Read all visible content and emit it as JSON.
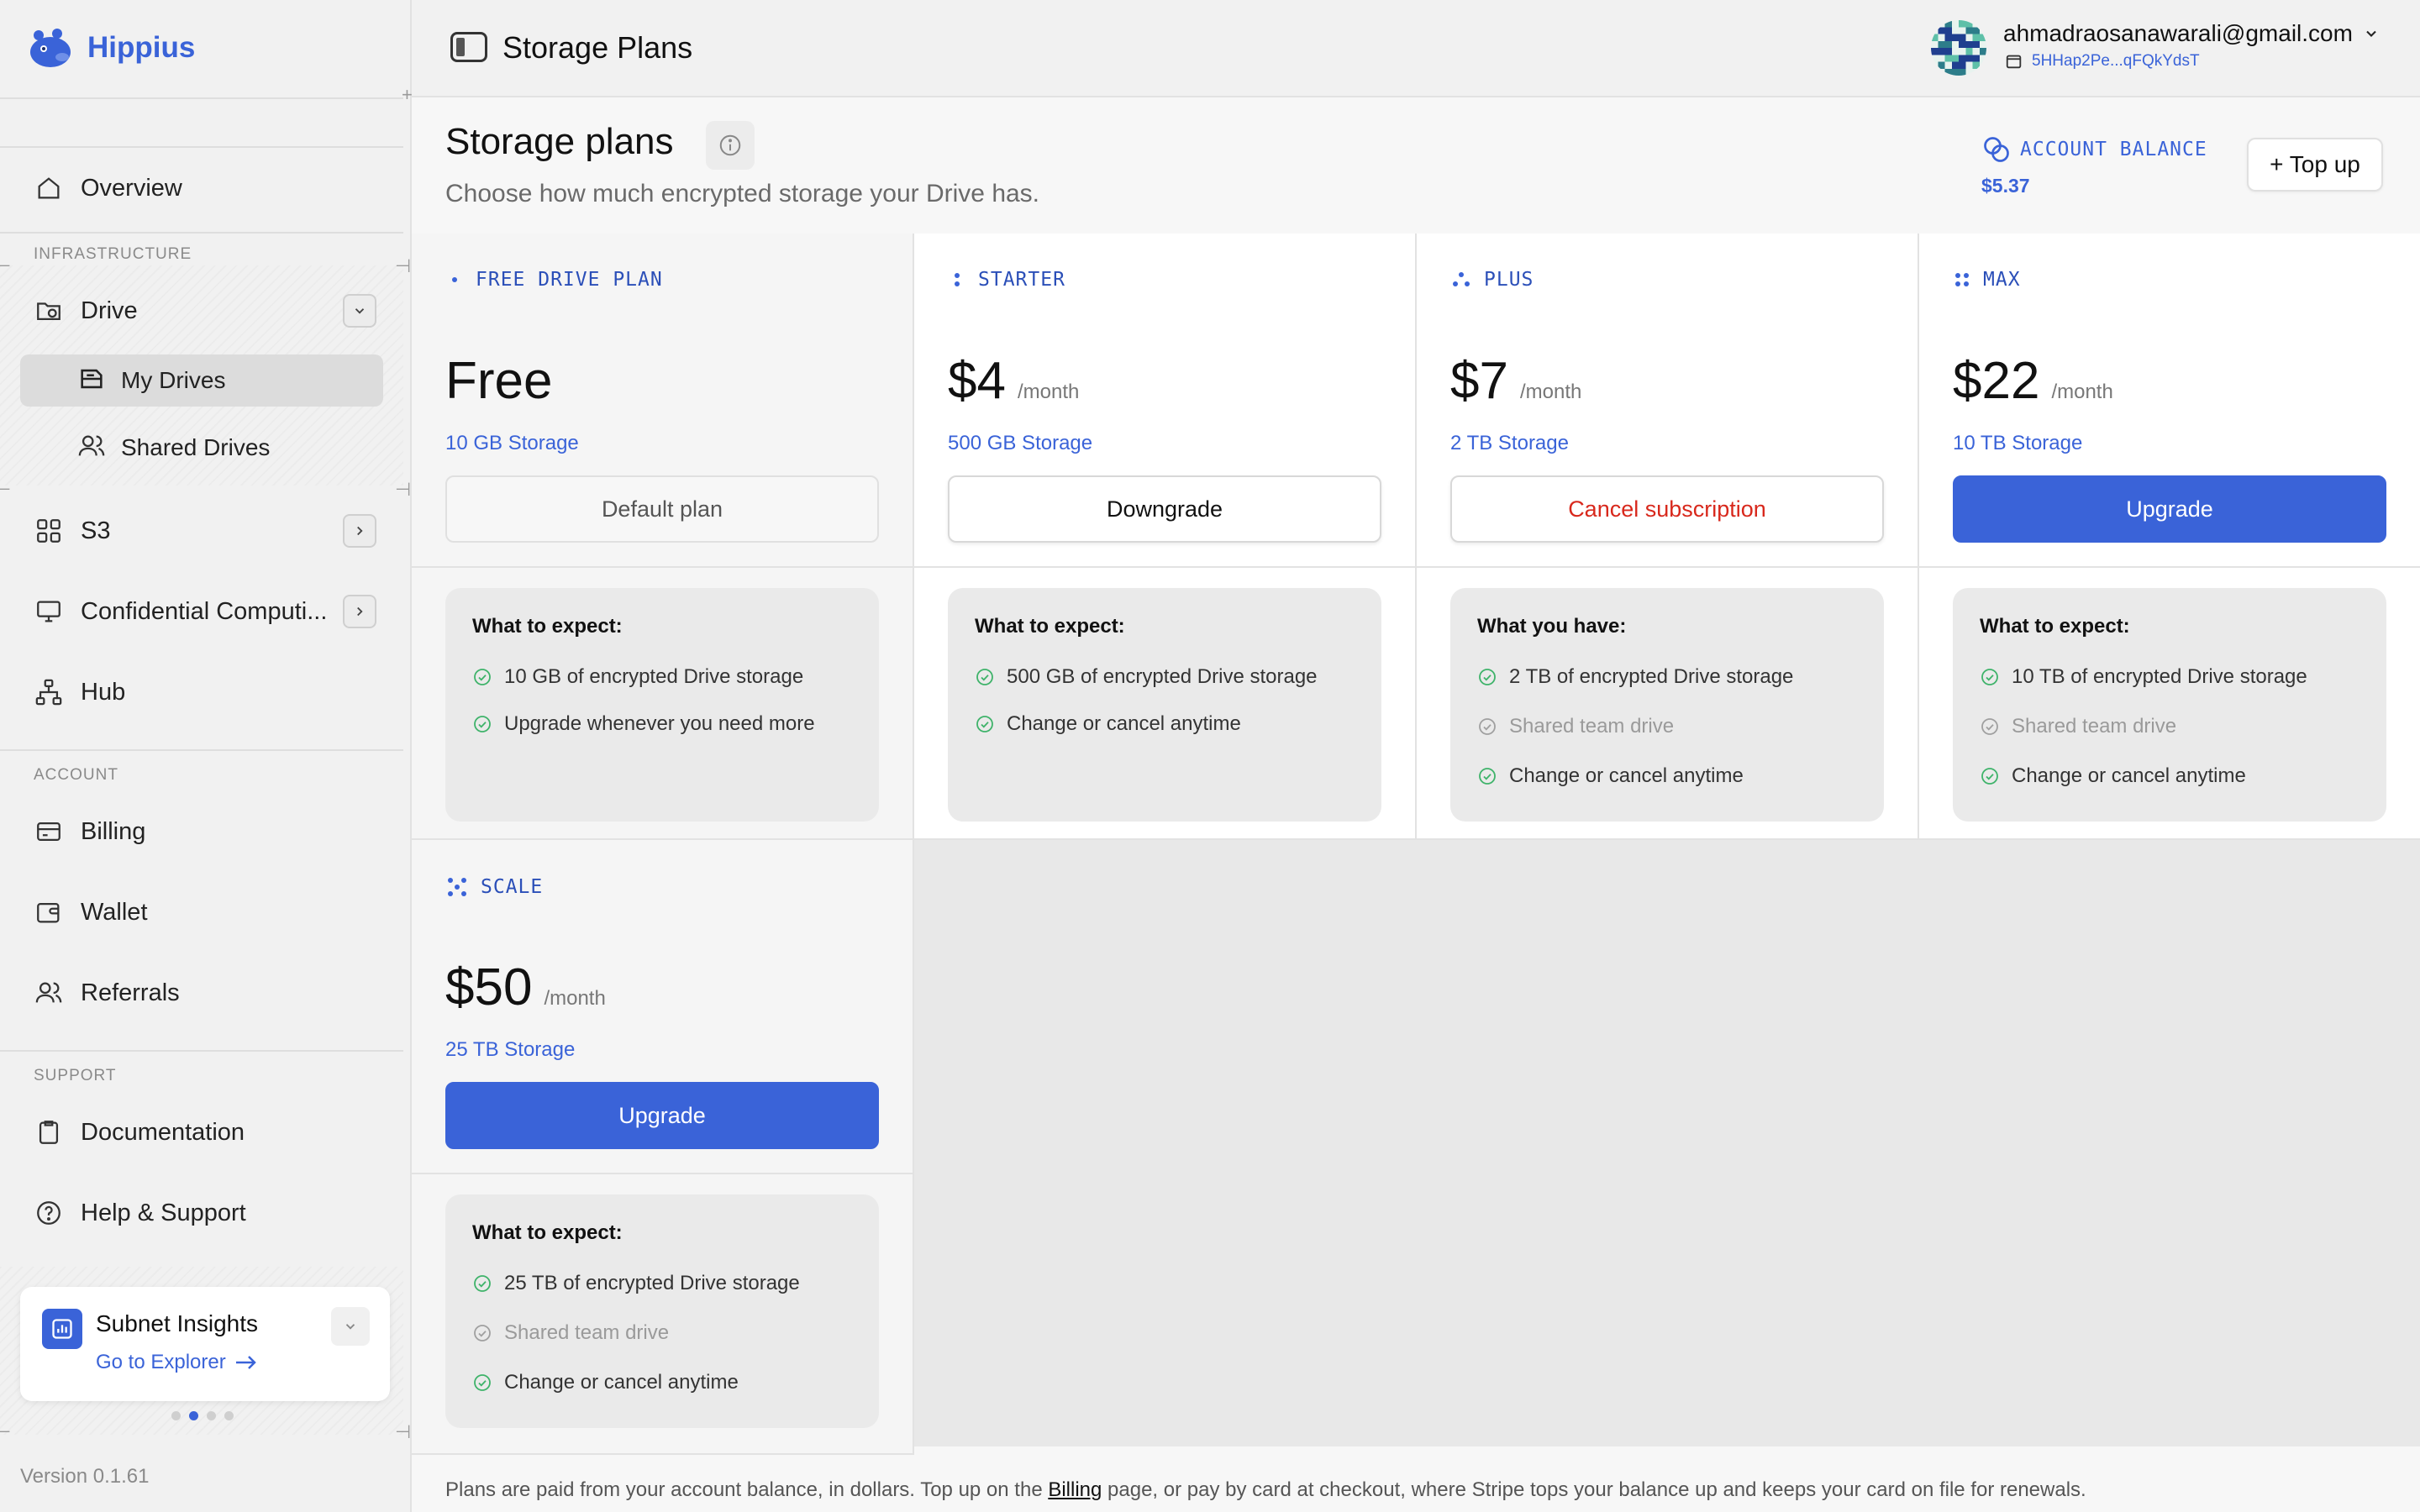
{
  "app": {
    "name": "Hippius"
  },
  "sidebar": {
    "overview": "Overview",
    "sections": {
      "infrastructure": "INFRASTRUCTURE",
      "account": "ACCOUNT",
      "support": "SUPPORT"
    },
    "drive": "Drive",
    "my_drives": "My Drives",
    "shared_drives": "Shared Drives",
    "s3": "S3",
    "confidential": "Confidential Computi...",
    "hub": "Hub",
    "billing": "Billing",
    "wallet": "Wallet",
    "referrals": "Referrals",
    "documentation": "Documentation",
    "help": "Help & Support",
    "insights": {
      "title": "Subnet Insights",
      "link": "Go to Explorer",
      "slides": 4,
      "active_slide": 2
    },
    "version": "Version 0.1.61"
  },
  "header": {
    "title": "Storage Plans",
    "email": "ahmadraosanawarali@gmail.com",
    "wallet_address": "5HHap2Pe...qFQkYdsT"
  },
  "main": {
    "title": "Storage plans",
    "subtitle": "Choose how much encrypted storage your Drive has.",
    "balance_label": "ACCOUNT BALANCE",
    "balance_value": "$5.37",
    "topup_label": "+ Top up",
    "footnote_pre": "Plans are paid from your account balance, in dollars. Top up on the ",
    "footnote_link": "Billing",
    "footnote_post": " page, or pay by card at checkout, where Stripe tops your balance up and keeps your card on file for renewals."
  },
  "plans": [
    {
      "tag": "FREE DRIVE PLAN",
      "price": "Free",
      "period": "",
      "storage": "10 GB Storage",
      "button": "Default plan",
      "button_style": "default",
      "heading": "What to expect:",
      "features": [
        {
          "text": "10 GB of encrypted Drive storage",
          "on": true
        },
        {
          "text": "Upgrade whenever you need more",
          "on": true
        }
      ]
    },
    {
      "tag": "STARTER",
      "price": "$4",
      "period": "/month",
      "storage": "500 GB Storage",
      "button": "Downgrade",
      "button_style": "white",
      "heading": "What to expect:",
      "features": [
        {
          "text": "500 GB of encrypted Drive storage",
          "on": true
        },
        {
          "text": "Change or cancel anytime",
          "on": true
        }
      ]
    },
    {
      "tag": "PLUS",
      "price": "$7",
      "period": "/month",
      "storage": "2 TB Storage",
      "button": "Cancel subscription",
      "button_style": "danger",
      "heading": "What you have:",
      "features": [
        {
          "text": "2 TB of encrypted Drive storage",
          "on": true
        },
        {
          "text": "Shared team drive",
          "on": false
        },
        {
          "text": "Change or cancel anytime",
          "on": true
        }
      ]
    },
    {
      "tag": "MAX",
      "price": "$22",
      "period": "/month",
      "storage": "10 TB Storage",
      "button": "Upgrade",
      "button_style": "primary",
      "heading": "What to expect:",
      "features": [
        {
          "text": "10 TB of encrypted Drive storage",
          "on": true
        },
        {
          "text": "Shared team drive",
          "on": false
        },
        {
          "text": "Change or cancel anytime",
          "on": true
        }
      ]
    },
    {
      "tag": "SCALE",
      "price": "$50",
      "period": "/month",
      "storage": "25 TB Storage",
      "button": "Upgrade",
      "button_style": "primary",
      "heading": "What to expect:",
      "features": [
        {
          "text": "25 TB of encrypted Drive storage",
          "on": true
        },
        {
          "text": "Shared team drive",
          "on": false
        },
        {
          "text": "Change or cancel anytime",
          "on": true
        }
      ]
    }
  ],
  "colors": {
    "accent": "#3a63d8",
    "danger": "#d8281c",
    "check": "#3fb36a"
  }
}
